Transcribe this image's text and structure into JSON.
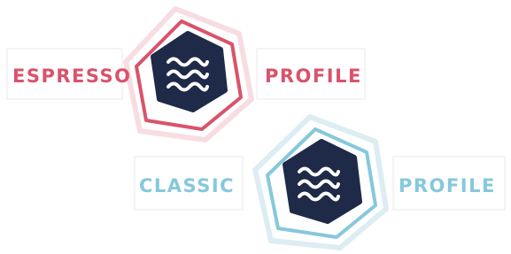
{
  "badges": [
    {
      "left_label": "ESPRESSO",
      "right_label": "PROFILE",
      "accent_color": "#d9536b",
      "accent_soft_color": "#f7dde2",
      "icon_bg_color": "#1e2a47",
      "icon": "waves-icon"
    },
    {
      "left_label": "CLASSIC",
      "right_label": "PROFILE",
      "accent_color": "#86c8dc",
      "accent_soft_color": "#dcedf3",
      "icon_bg_color": "#1e2a47",
      "icon": "waves-icon"
    }
  ]
}
